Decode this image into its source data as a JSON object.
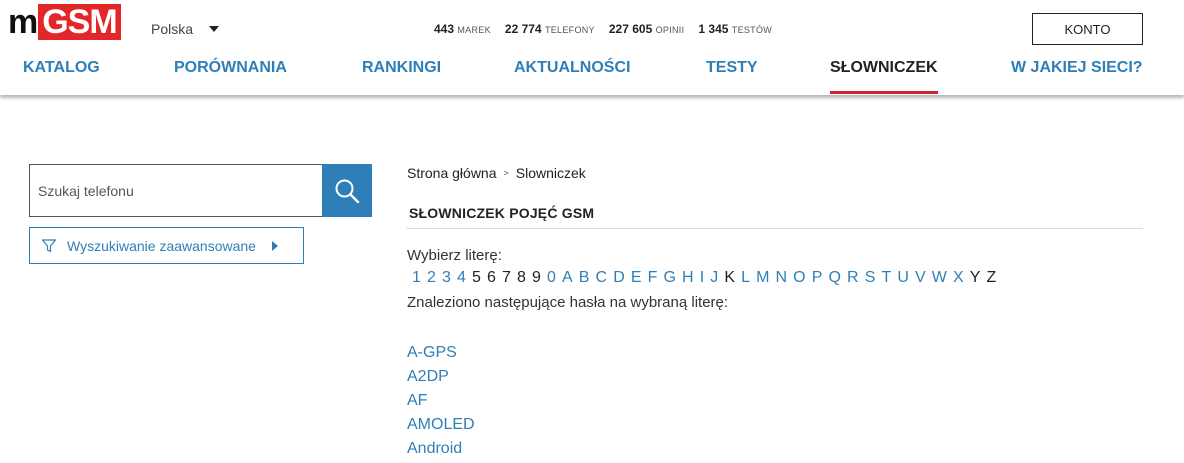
{
  "header": {
    "logo_m": "m",
    "logo_gsm": "GSM",
    "country": "Polska",
    "stats": [
      {
        "value": "443",
        "label": "MAREK"
      },
      {
        "value": "22 774",
        "label": "TELEFONY"
      },
      {
        "value": "227 605",
        "label": "OPINII"
      },
      {
        "value": "1 345",
        "label": "TESTÓW"
      }
    ],
    "account_label": "KONTO"
  },
  "nav": {
    "items": [
      "KATALOG",
      "PORÓWNANIA",
      "RANKINGI",
      "AKTUALNOŚCI",
      "TESTY",
      "SŁOWNICZEK",
      "W JAKIEJ SIECI?"
    ],
    "active": "SŁOWNICZEK"
  },
  "search": {
    "placeholder": "Szukaj telefonu",
    "advanced_label": "Wyszukiwanie zaawansowane"
  },
  "breadcrumb": {
    "home": "Strona główna",
    "separator": ">",
    "current": "Slowniczek"
  },
  "glossary": {
    "title": "SŁOWNICZEK POJĘĆ GSM",
    "choose_letter": "Wybierz literę:",
    "letters": [
      {
        "char": "1",
        "link": true
      },
      {
        "char": "2",
        "link": true
      },
      {
        "char": "3",
        "link": true
      },
      {
        "char": "4",
        "link": true
      },
      {
        "char": "5",
        "link": false
      },
      {
        "char": "6",
        "link": false
      },
      {
        "char": "7",
        "link": false
      },
      {
        "char": "8",
        "link": false
      },
      {
        "char": "9",
        "link": false
      },
      {
        "char": "0",
        "link": true
      },
      {
        "char": "A",
        "link": true
      },
      {
        "char": "B",
        "link": true
      },
      {
        "char": "C",
        "link": true
      },
      {
        "char": "D",
        "link": true
      },
      {
        "char": "E",
        "link": true
      },
      {
        "char": "F",
        "link": true
      },
      {
        "char": "G",
        "link": true
      },
      {
        "char": "H",
        "link": true
      },
      {
        "char": "I",
        "link": true
      },
      {
        "char": "J",
        "link": true
      },
      {
        "char": "K",
        "link": false
      },
      {
        "char": "L",
        "link": true
      },
      {
        "char": "M",
        "link": true
      },
      {
        "char": "N",
        "link": true
      },
      {
        "char": "O",
        "link": true
      },
      {
        "char": "P",
        "link": true
      },
      {
        "char": "Q",
        "link": true
      },
      {
        "char": "R",
        "link": true
      },
      {
        "char": "S",
        "link": true
      },
      {
        "char": "T",
        "link": true
      },
      {
        "char": "U",
        "link": true
      },
      {
        "char": "V",
        "link": true
      },
      {
        "char": "W",
        "link": true
      },
      {
        "char": "X",
        "link": true
      },
      {
        "char": "Y",
        "link": false
      },
      {
        "char": "Z",
        "link": false
      }
    ],
    "found_text": "Znaleziono następujące hasła na wybraną literę:",
    "terms": [
      "A-GPS",
      "A2DP",
      "AF",
      "AMOLED",
      "Android"
    ]
  },
  "colors": {
    "accent": "#2e7fb8",
    "brand_red": "#e3262a",
    "active_underline": "#c9252b"
  }
}
